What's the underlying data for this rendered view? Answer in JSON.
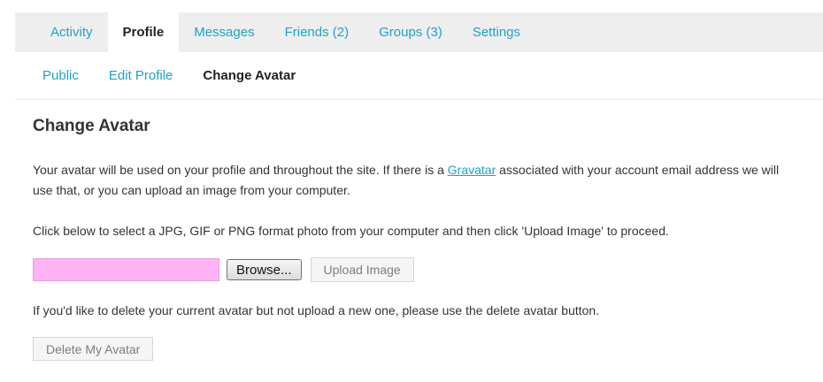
{
  "primary_nav": {
    "tabs": [
      {
        "label": "Activity",
        "active": false
      },
      {
        "label": "Profile",
        "active": true
      },
      {
        "label": "Messages",
        "active": false
      },
      {
        "label": "Friends (2)",
        "active": false
      },
      {
        "label": "Groups (3)",
        "active": false
      },
      {
        "label": "Settings",
        "active": false
      }
    ]
  },
  "secondary_nav": {
    "tabs": [
      {
        "label": "Public",
        "active": false
      },
      {
        "label": "Edit Profile",
        "active": false
      },
      {
        "label": "Change Avatar",
        "active": true
      }
    ]
  },
  "main": {
    "heading": "Change Avatar",
    "intro_before_link": "Your avatar will be used on your profile and throughout the site. If there is a ",
    "intro_link": "Gravatar",
    "intro_after_link": " associated with your account email address we will",
    "intro_line2": "use that, or you can upload an image from your computer.",
    "instructions": "Click below to select a JPG, GIF or PNG format photo from your computer and then click 'Upload Image' to proceed.",
    "file_input_value": "",
    "browse_label": "Browse...",
    "upload_label": "Upload Image",
    "delete_note": "If you'd like to delete your current avatar but not upload a new one, please use the delete avatar button.",
    "delete_label": "Delete My Avatar"
  },
  "colors": {
    "link": "#1fa1c6",
    "nav_bg": "#eeeeee",
    "file_field_bg": "#ffb3f5"
  }
}
